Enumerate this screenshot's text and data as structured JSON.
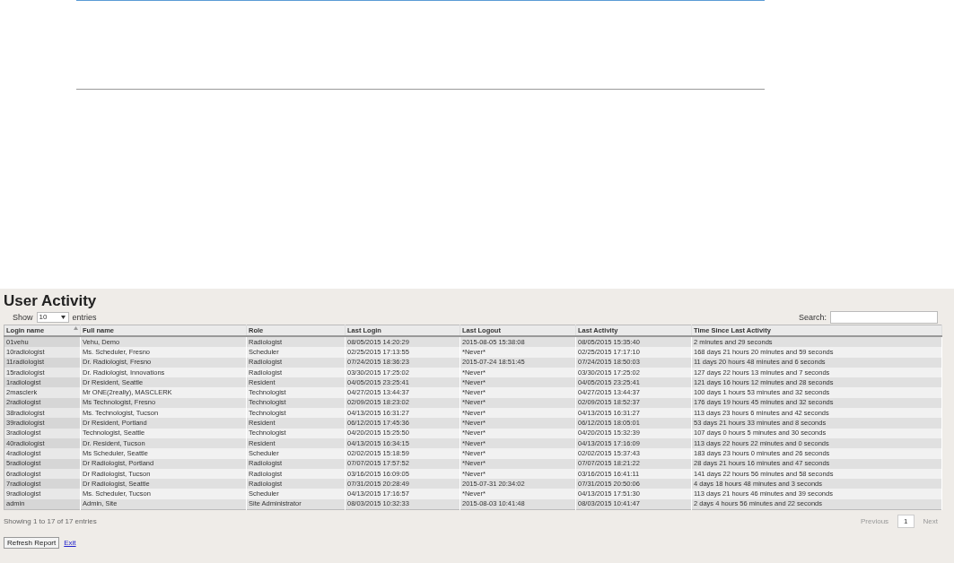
{
  "title": "User Activity",
  "length_menu": {
    "label_before": "Show",
    "value": "10",
    "label_after": "entries"
  },
  "search": {
    "label": "Search:"
  },
  "table": {
    "columns": [
      {
        "label": "Login name",
        "sorted": true
      },
      {
        "label": "Full name",
        "sorted": false
      },
      {
        "label": "Role",
        "sorted": false
      },
      {
        "label": "Last Login",
        "sorted": false
      },
      {
        "label": "Last Logout",
        "sorted": false
      },
      {
        "label": "Last Activity",
        "sorted": false
      },
      {
        "label": "Time Since Last Activity",
        "sorted": false
      }
    ],
    "rows": [
      [
        "01vehu",
        "Vehu, Demo",
        "Radiologist",
        "08/05/2015 14:20:29",
        "2015-08-05 15:38:08",
        "08/05/2015 15:35:40",
        "2 minutes and 29 seconds"
      ],
      [
        "10radiologist",
        "Ms. Scheduler, Fresno",
        "Scheduler",
        "02/25/2015 17:13:55",
        "*Never*",
        "02/25/2015 17:17:10",
        "168 days 21 hours 20 minutes and 59 seconds"
      ],
      [
        "11radiologist",
        "Dr. Radiologist, Fresno",
        "Radiologist",
        "07/24/2015 18:36:23",
        "2015-07-24 18:51:45",
        "07/24/2015 18:50:03",
        "11 days 20 hours 48 minutes and 6 seconds"
      ],
      [
        "15radiologist",
        "Dr. Radiologist, Innovations",
        "Radiologist",
        "03/30/2015 17:25:02",
        "*Never*",
        "03/30/2015 17:25:02",
        "127 days 22 hours 13 minutes and 7 seconds"
      ],
      [
        "1radiologist",
        "Dr Resident, Seattle",
        "Resident",
        "04/05/2015 23:25:41",
        "*Never*",
        "04/05/2015 23:25:41",
        "121 days 16 hours 12 minutes and 28 seconds"
      ],
      [
        "2masclerk",
        "Mr ONE(2really), MASCLERK",
        "Technologist",
        "04/27/2015 13:44:37",
        "*Never*",
        "04/27/2015 13:44:37",
        "100 days 1 hours 53 minutes and 32 seconds"
      ],
      [
        "2radiologist",
        "Ms Technologist, Fresno",
        "Technologist",
        "02/09/2015 18:23:02",
        "*Never*",
        "02/09/2015 18:52:37",
        "176 days 19 hours 45 minutes and 32 seconds"
      ],
      [
        "38radiologist",
        "Ms. Technologist, Tucson",
        "Technologist",
        "04/13/2015 16:31:27",
        "*Never*",
        "04/13/2015 16:31:27",
        "113 days 23 hours 6 minutes and 42 seconds"
      ],
      [
        "39radiologist",
        "Dr Resident, Portland",
        "Resident",
        "06/12/2015 17:45:36",
        "*Never*",
        "06/12/2015 18:05:01",
        "53 days 21 hours 33 minutes and 8 seconds"
      ],
      [
        "3radiologist",
        "Technologist, Seattle",
        "Technologist",
        "04/20/2015 15:25:50",
        "*Never*",
        "04/20/2015 15:32:39",
        "107 days 0 hours 5 minutes and 30 seconds"
      ],
      [
        "40radiologist",
        "Dr. Resident, Tucson",
        "Resident",
        "04/13/2015 16:34:15",
        "*Never*",
        "04/13/2015 17:16:09",
        "113 days 22 hours 22 minutes and 0 seconds"
      ],
      [
        "4radiologist",
        "Ms Scheduler, Seattle",
        "Scheduler",
        "02/02/2015 15:18:59",
        "*Never*",
        "02/02/2015 15:37:43",
        "183 days 23 hours 0 minutes and 26 seconds"
      ],
      [
        "5radiologist",
        "Dr Radiologist, Portland",
        "Radiologist",
        "07/07/2015 17:57:52",
        "*Never*",
        "07/07/2015 18:21:22",
        "28 days 21 hours 16 minutes and 47 seconds"
      ],
      [
        "6radiologist",
        "Dr Radiologist, Tucson",
        "Radiologist",
        "03/16/2015 16:09:05",
        "*Never*",
        "03/16/2015 16:41:11",
        "141 days 22 hours 56 minutes and 58 seconds"
      ],
      [
        "7radiologist",
        "Dr Radiologist, Seattle",
        "Radiologist",
        "07/31/2015 20:28:49",
        "2015-07-31 20:34:02",
        "07/31/2015 20:50:06",
        "4 days 18 hours 48 minutes and 3 seconds"
      ],
      [
        "9radiologist",
        "Ms. Scheduler, Tucson",
        "Scheduler",
        "04/13/2015 17:16:57",
        "*Never*",
        "04/13/2015 17:51:30",
        "113 days 21 hours 46 minutes and 39 seconds"
      ],
      [
        "admin",
        "Admin, Site",
        "Site Administrator",
        "08/03/2015 10:32:33",
        "2015-08-03 10:41:48",
        "08/03/2015 10:41:47",
        "2 days 4 hours 56 minutes and 22 seconds"
      ]
    ]
  },
  "info": "Showing 1 to 17 of 17 entries",
  "pagination": [
    {
      "label": "Previous",
      "kind": "prev",
      "disabled": true
    },
    {
      "label": "1",
      "kind": "page",
      "selected": true
    },
    {
      "label": "Next",
      "kind": "next",
      "disabled": true
    }
  ],
  "actions": [
    {
      "label": "Refresh Report",
      "kind": "button"
    },
    {
      "label": "Exit",
      "kind": "link"
    }
  ]
}
